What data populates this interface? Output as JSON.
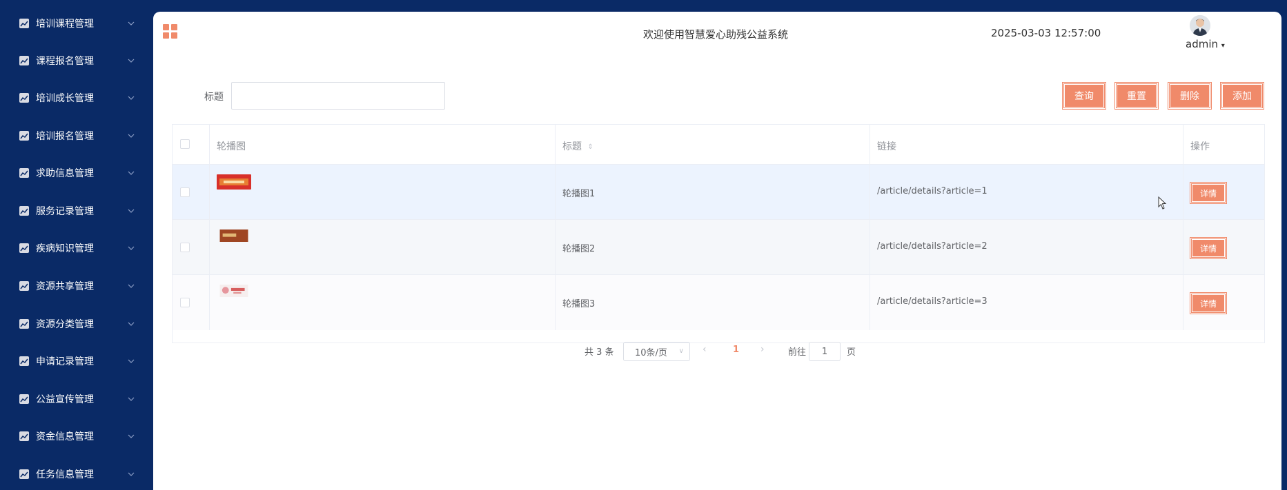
{
  "sidebar": {
    "items": [
      {
        "label": "培训课程管理"
      },
      {
        "label": "课程报名管理"
      },
      {
        "label": "培训成长管理"
      },
      {
        "label": "培训报名管理"
      },
      {
        "label": "求助信息管理"
      },
      {
        "label": "服务记录管理"
      },
      {
        "label": "疾病知识管理"
      },
      {
        "label": "资源共享管理"
      },
      {
        "label": "资源分类管理"
      },
      {
        "label": "申请记录管理"
      },
      {
        "label": "公益宣传管理"
      },
      {
        "label": "资金信息管理"
      },
      {
        "label": "任务信息管理"
      }
    ]
  },
  "header": {
    "welcome": "欢迎使用智慧爱心助残公益系统",
    "datetime": "2025-03-03 12:57:00",
    "user": "admin"
  },
  "search": {
    "label": "标题",
    "value": ""
  },
  "toolbar": {
    "query_label": "查询",
    "reset_label": "重置",
    "delete_label": "删除",
    "add_label": "添加"
  },
  "table": {
    "columns": [
      "轮播图",
      "标题",
      "链接",
      "操作"
    ],
    "rows": [
      {
        "image": "carousel-image-1",
        "title": "轮播图1",
        "link": "/article/details?article=1",
        "action": "详情",
        "bg": "#ecf3fe"
      },
      {
        "image": "carousel-image-2",
        "title": "轮播图2",
        "link": "/article/details?article=2",
        "action": "详情",
        "bg": "#f5f7fa"
      },
      {
        "image": "carousel-image-3",
        "title": "轮播图3",
        "link": "/article/details?article=3",
        "action": "详情",
        "bg": "#fbfbfd"
      }
    ]
  },
  "pagination": {
    "total": "共 3 条",
    "page_size": "10条/页",
    "current": "1",
    "goto_label": "前往",
    "goto_value": "1",
    "page_suffix": "页"
  },
  "colors": {
    "sidebar_bg": "#0a2a66",
    "accent": "#f08a6a",
    "row_hover": "#ecf3fe"
  }
}
